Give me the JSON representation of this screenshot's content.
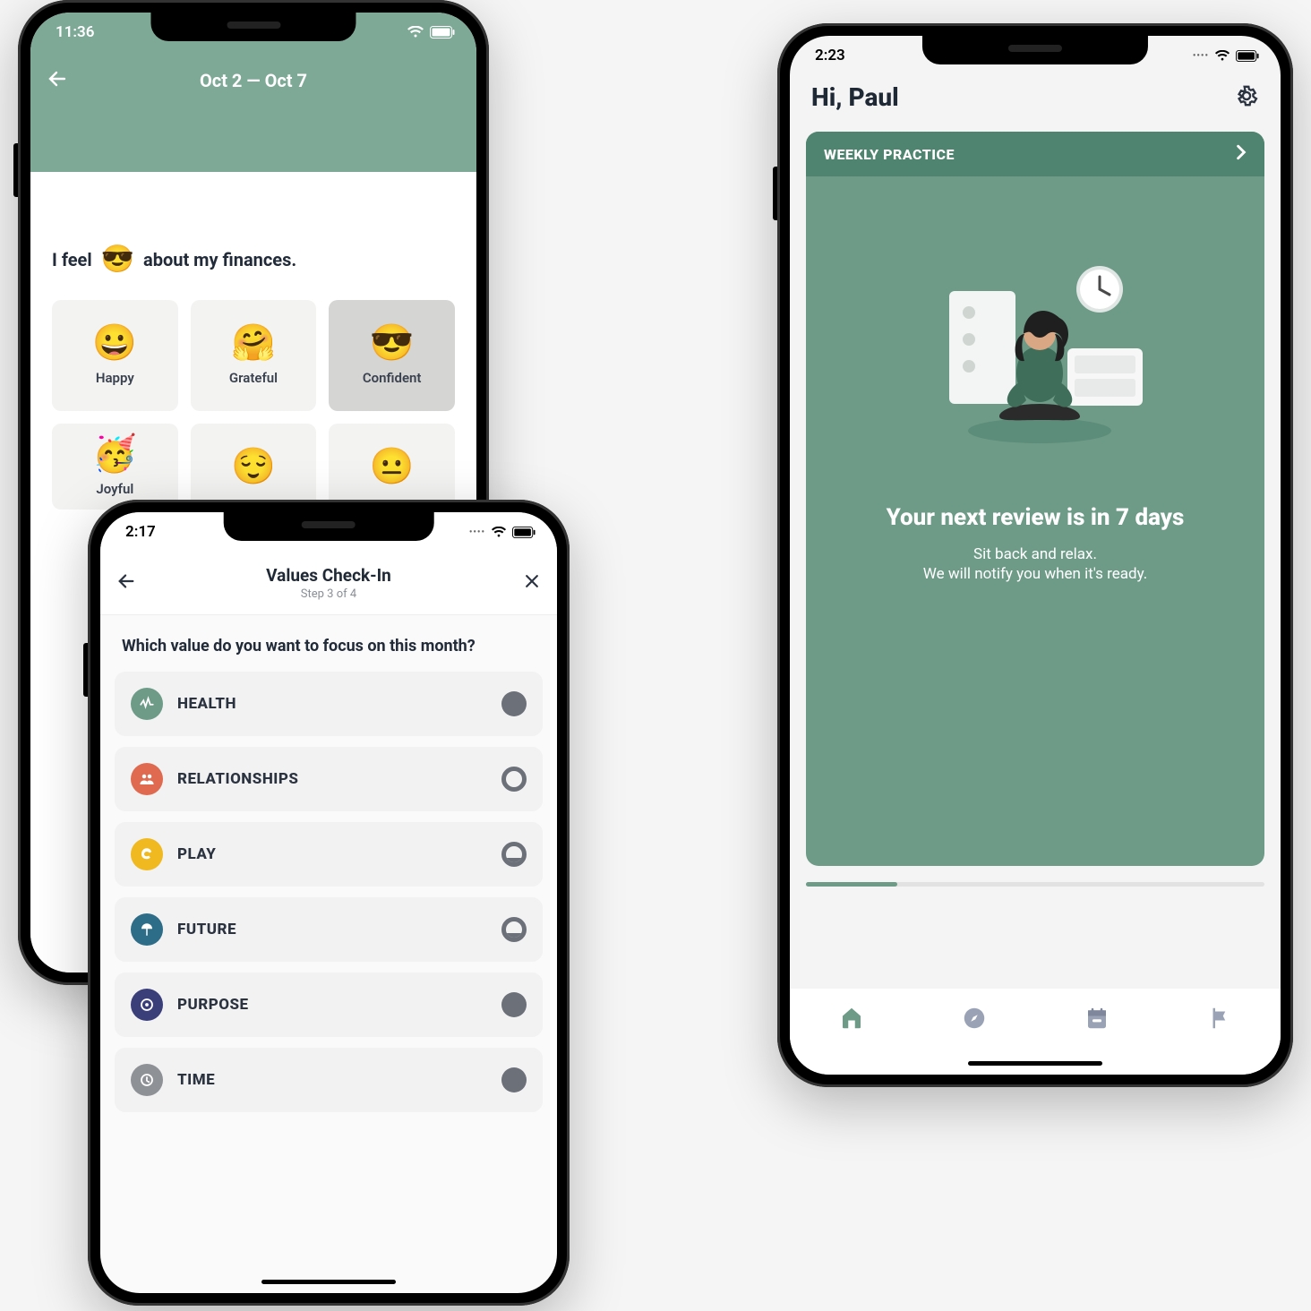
{
  "phone1": {
    "status_time": "11:36",
    "date_range": "Oct 2 — Oct 7",
    "sentence_pre": "I feel",
    "sentence_emoji": "😎",
    "sentence_post": "about my finances.",
    "moods_row1": [
      {
        "emoji": "😀",
        "label": "Happy"
      },
      {
        "emoji": "🤗",
        "label": "Grateful"
      },
      {
        "emoji": "😎",
        "label": "Confident",
        "selected": true
      }
    ],
    "moods_row2": [
      {
        "emoji": "🥳",
        "label": "Joyful"
      },
      {
        "emoji": "😌",
        "label": ""
      },
      {
        "emoji": "😐",
        "label": ""
      }
    ]
  },
  "phone2": {
    "status_time": "2:17",
    "title": "Values Check-In",
    "step": "Step 3 of 4",
    "question": "Which value do you want to focus on this month?",
    "values": [
      {
        "label": "HEALTH",
        "icon": "health",
        "color": "#6e9b88",
        "indicator": "solid"
      },
      {
        "label": "RELATIONSHIPS",
        "icon": "relationships",
        "color": "#e06a50",
        "indicator": "ring"
      },
      {
        "label": "PLAY",
        "icon": "play",
        "color": "#f0b91f",
        "indicator": "half"
      },
      {
        "label": "FUTURE",
        "icon": "future",
        "color": "#2e6d87",
        "indicator": "half"
      },
      {
        "label": "PURPOSE",
        "icon": "purpose",
        "color": "#3a3f7a",
        "indicator": "solid"
      },
      {
        "label": "TIME",
        "icon": "time",
        "color": "#8e9196",
        "indicator": "solid"
      }
    ]
  },
  "phone3": {
    "status_time": "2:23",
    "greeting": "Hi, Paul",
    "card_header": "WEEKLY PRACTICE",
    "headline": "Your next review is in 7 days",
    "sub1": "Sit back and relax.",
    "sub2": "We will notify you when it's ready.",
    "nav": [
      "home",
      "compass",
      "calendar",
      "flag"
    ]
  }
}
